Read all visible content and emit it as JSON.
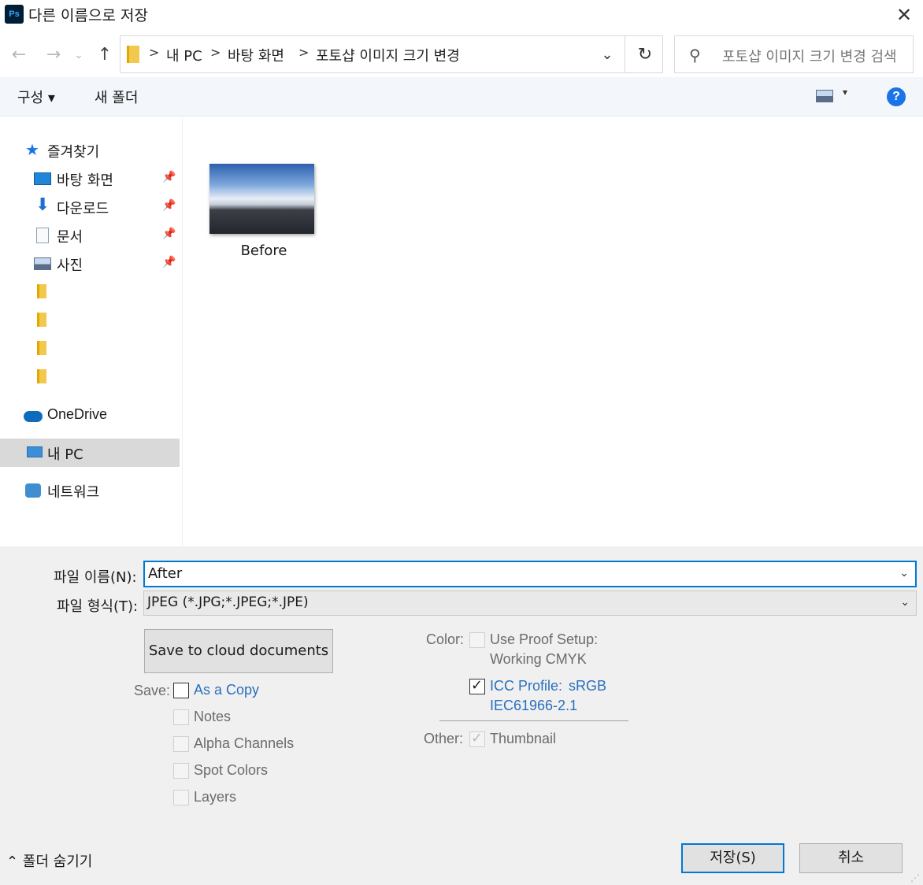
{
  "window": {
    "app_icon_text": "Ps",
    "title": "다른 이름으로 저장",
    "close_glyph": "✕"
  },
  "nav": {
    "back_glyph": "←",
    "forward_glyph": "→",
    "recent_glyph": "⌄",
    "up_glyph": "↑"
  },
  "address": {
    "separator": ">",
    "crumbs": [
      "내 PC",
      "바탕 화면",
      "포토샵 이미지 크기 변경"
    ],
    "dropdown_glyph": "⌄",
    "refresh_glyph": "↻"
  },
  "search": {
    "icon": "search-icon",
    "icon_glyph": "⚲",
    "placeholder": "포토샵 이미지 크기 변경 검색"
  },
  "toolbar": {
    "organize_label": "구성 ▾",
    "new_folder_label": "새 폴더",
    "view_dropdown_glyph": "▾",
    "help_glyph": "?"
  },
  "sidebar": {
    "pin_glyph": "📌",
    "favorites": "즐겨찾기",
    "items": [
      {
        "label": "바탕 화면",
        "icon": "desktop-icon"
      },
      {
        "label": "다운로드",
        "icon": "download-icon"
      },
      {
        "label": "문서",
        "icon": "document-icon"
      },
      {
        "label": "사진",
        "icon": "pictures-icon"
      }
    ],
    "onedrive": "OneDrive",
    "mypc": "내 PC",
    "network": "네트워크"
  },
  "content": {
    "files": [
      {
        "name": "Before",
        "icon": "image-thumbnail"
      }
    ]
  },
  "form": {
    "filename_label": "파일 이름(N):",
    "filename_value": "After",
    "filetype_label": "파일 형식(T):",
    "filetype_value": "JPEG (*.JPG;*.JPEG;*.JPE)",
    "dropdown_glyph": "⌄"
  },
  "options": {
    "cloud_button": "Save to cloud documents",
    "save_label": "Save:",
    "as_a_copy": "As a Copy",
    "notes": "Notes",
    "alpha_channels": "Alpha Channels",
    "spot_colors": "Spot Colors",
    "layers": "Layers",
    "color_label": "Color:",
    "use_proof_setup": "Use Proof Setup:",
    "working_cmyk": "Working CMYK",
    "icc_profile": "ICC Profile:",
    "icc_profile_value": "sRGB",
    "icc_profile_value2": "IEC61966-2.1",
    "other_label": "Other:",
    "thumbnail": "Thumbnail",
    "check_glyph": "✓",
    "checked": {
      "as_a_copy": false,
      "icc_profile": true,
      "thumbnail": true
    }
  },
  "footer": {
    "hide_folders": "⌃ 폴더 숨기기",
    "save_button": "저장(S)",
    "cancel_button": "취소",
    "resize_glyph": "⋰"
  },
  "colors": {
    "accent": "#0078d4",
    "help_blue": "#1a73e8",
    "link_blue": "#2a6fbd",
    "selected_bg": "#d9d9d9"
  }
}
